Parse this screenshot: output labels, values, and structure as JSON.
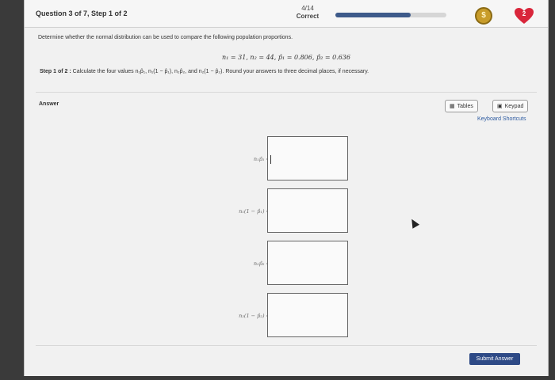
{
  "header": {
    "question_label": "Question 3 of 7, Step 1 of 2",
    "score_fraction": "4/14",
    "score_status": "Correct",
    "progress_fraction": 0.68,
    "coin_symbol": "$",
    "heart_count": "2"
  },
  "problem": {
    "prompt": "Determine whether the normal distribution can be used to compare the following population proportions.",
    "given": "n₁ = 31,  n₂ = 44,  p̂₁ = 0.806,  p̂₂ = 0.636",
    "step_label": "Step 1 of 2 :",
    "step_text": "Calculate the four values n₁p̂₁, n₁(1 − p̂₁), n₂p̂₂, and n₂(1 − p̂₂). Round your answers to three decimal places, if necessary."
  },
  "answer": {
    "label": "Answer",
    "tables_label": "Tables",
    "keypad_label": "Keypad",
    "shortcuts_label": "Keyboard Shortcuts",
    "rows": [
      {
        "label": "n₁p̂₁ =",
        "value": ""
      },
      {
        "label": "n₁(1 − p̂₁) =",
        "value": ""
      },
      {
        "label": "n₂p̂₂ =",
        "value": ""
      },
      {
        "label": "n₂(1 − p̂₂) =",
        "value": ""
      }
    ],
    "submit_label": "Submit Answer"
  },
  "colors": {
    "accent": "#2e4a86",
    "progress": "#3d5a8a",
    "heart": "#d9263b",
    "coin": "#c89c2a"
  }
}
